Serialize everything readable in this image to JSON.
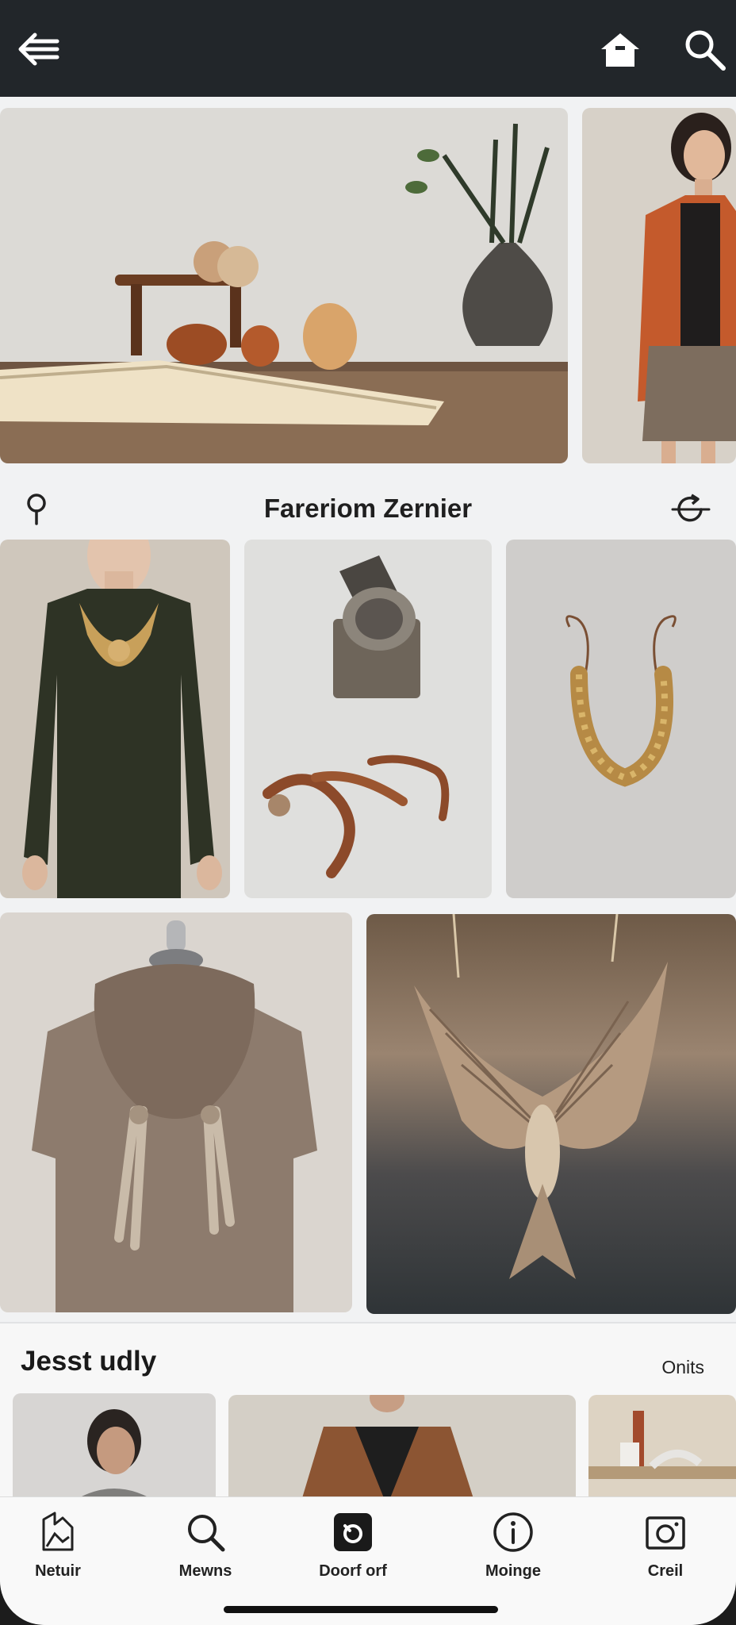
{
  "header": {
    "back_icon": "back-arrow-icon",
    "home_icon": "home-icon",
    "search_icon": "search-icon",
    "background": "#22262a"
  },
  "store": {
    "title": "Fareriom Zernier",
    "pin_icon": "location-pin-icon",
    "refresh_icon": "refresh-icon"
  },
  "gallery": {
    "items": [
      "still-life-books-vase",
      "woman-orange-jacket",
      "embroidered-tunic",
      "ceramic-cup-earrings",
      "beaded-necklace",
      "scarf-on-mannequin",
      "wing-pendant"
    ]
  },
  "section": {
    "title": "Jesst udly",
    "link": "Onits",
    "items": [
      "woman-grey-scarf",
      "man-tweed-blazer",
      "table-decor"
    ]
  },
  "nav": {
    "items": [
      {
        "label": "Netuir",
        "icon": "home-outline-icon"
      },
      {
        "label": "Mewns",
        "icon": "search-icon"
      },
      {
        "label": "Doorf orf",
        "icon": "bag-icon"
      },
      {
        "label": "Moinge",
        "icon": "info-icon"
      },
      {
        "label": "Creil",
        "icon": "camera-icon"
      }
    ]
  },
  "colors": {
    "screen_bg": "#f1f2f3",
    "text": "#1f1f1f"
  }
}
